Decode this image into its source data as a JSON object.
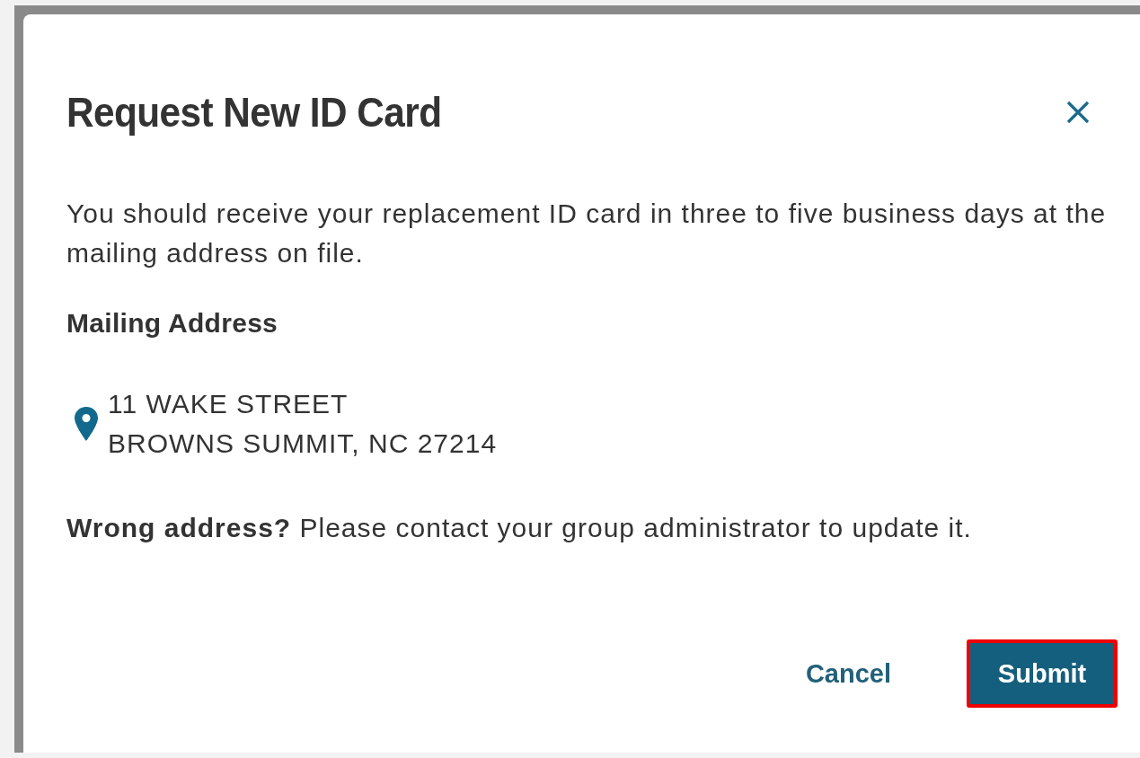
{
  "dialog": {
    "title": "Request New ID Card",
    "message": "You should receive your replacement ID card in three to five business days at the mailing address on file.",
    "address_heading": "Mailing Address",
    "address_lines": [
      "11 WAKE STREET",
      "BROWNS SUMMIT, NC 27214"
    ],
    "note": "**Wrong address?** Please contact your group administrator to update it.",
    "buttons": [
      {
        "label": "Cancel",
        "kind": "secondary",
        "highlighted": false
      },
      {
        "label": "Submit",
        "kind": "primary",
        "highlighted": true
      }
    ]
  }
}
